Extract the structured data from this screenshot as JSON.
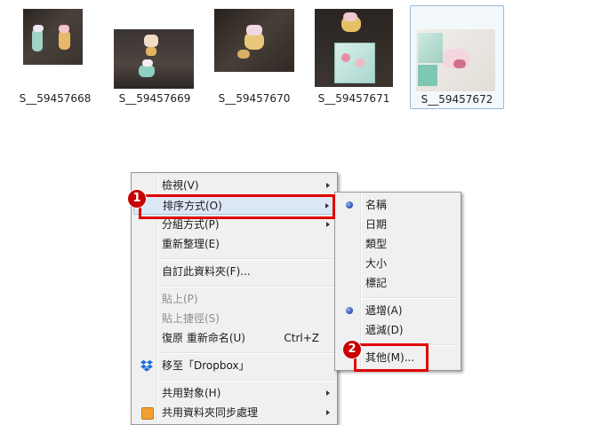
{
  "thumbnails": [
    {
      "name": "S__59457668",
      "selected": false
    },
    {
      "name": "S__59457669",
      "selected": false
    },
    {
      "name": "S__59457670",
      "selected": false
    },
    {
      "name": "S__59457671",
      "selected": false
    },
    {
      "name": "S__59457672",
      "selected": true
    }
  ],
  "context_menu": {
    "view": "檢視(V)",
    "sort_by": "排序方式(O)",
    "group_by": "分組方式(P)",
    "refresh": "重新整理(E)",
    "customize": "自訂此資料夾(F)...",
    "paste": "貼上(P)",
    "paste_shortcut": "貼上捷徑(S)",
    "undo_rename": "復原 重新命名(U)",
    "undo_shortcut": "Ctrl+Z",
    "move_to_dropbox": "移至「Dropbox」",
    "share_with": "共用對象(H)",
    "shared_folder_sync": "共用資料夾同步處理"
  },
  "sort_submenu": {
    "name": "名稱",
    "date": "日期",
    "type": "類型",
    "size": "大小",
    "tags": "標記",
    "ascending": "遞增(A)",
    "descending": "遞減(D)",
    "more": "其他(M)..."
  },
  "badges": {
    "step1": "1",
    "step2": "2"
  },
  "colors": {
    "highlight_border": "#e00000",
    "badge": "#c80000",
    "menu_bg": "#f0f0f0"
  }
}
